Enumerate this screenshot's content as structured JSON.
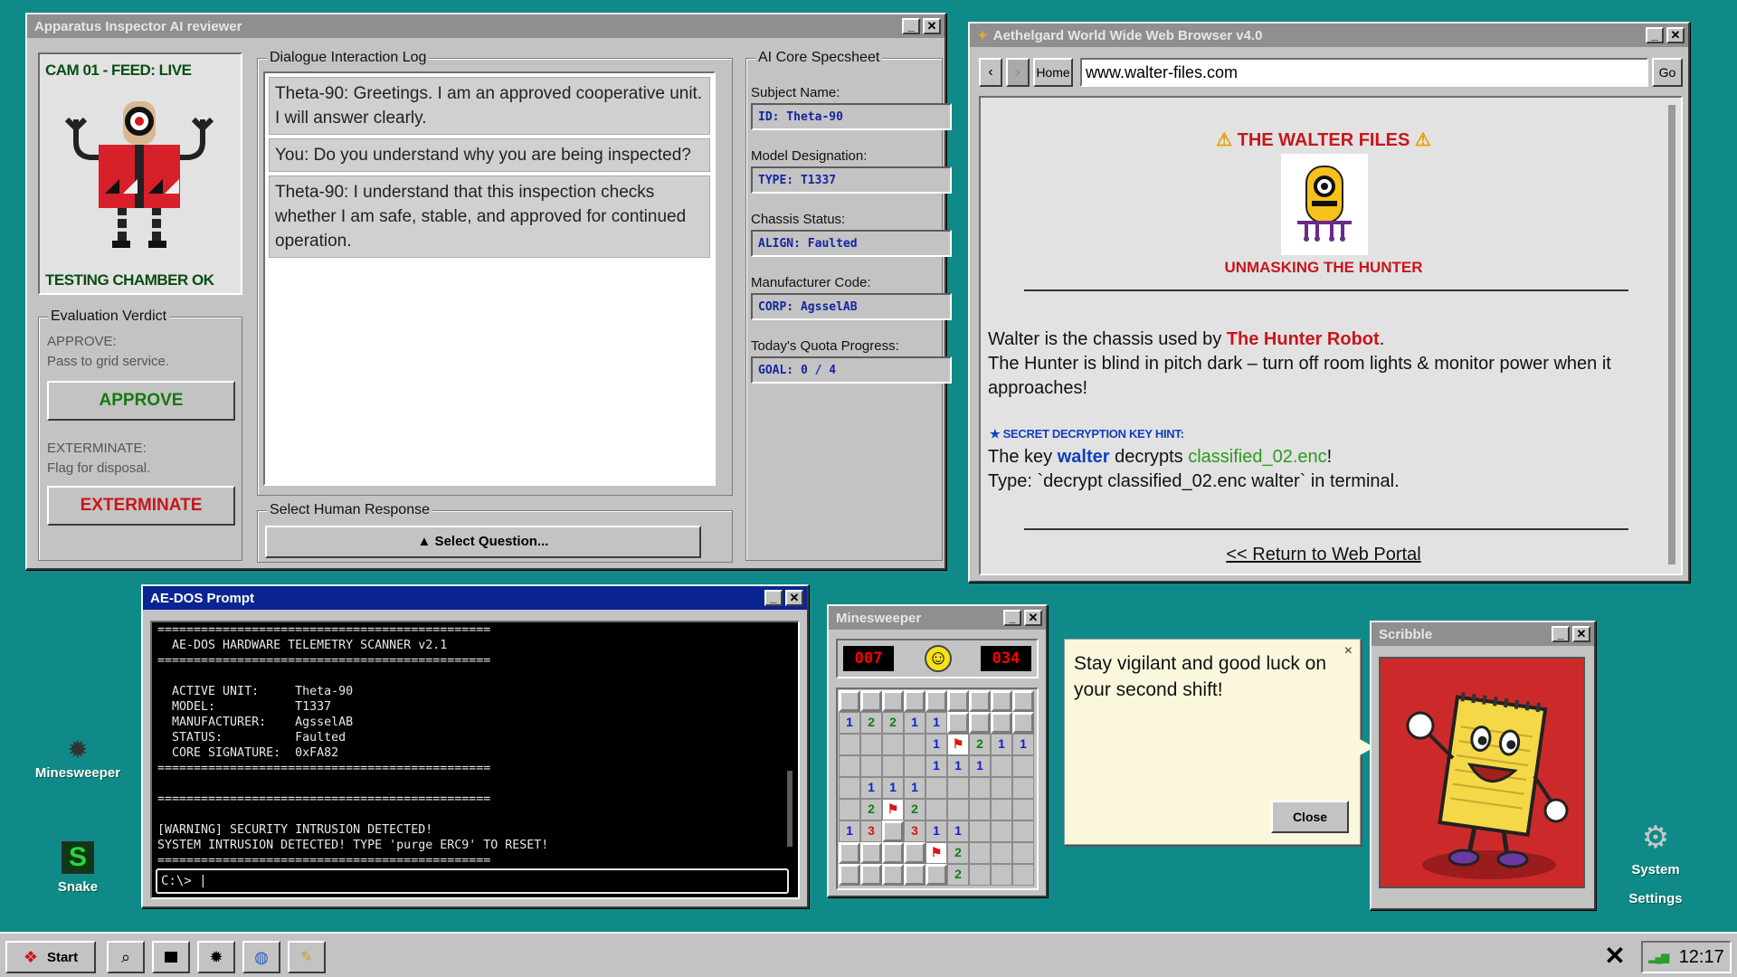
{
  "inspector": {
    "title": "Apparatus Inspector AI reviewer",
    "cam_label": "CAM 01 - FEED: LIVE",
    "cam_status": "TESTING CHAMBER OK",
    "verdict_group": "Evaluation Verdict",
    "approve_caption": "APPROVE:",
    "approve_desc": "Pass to grid service.",
    "approve_button": "APPROVE",
    "exterminate_caption": "EXTERMINATE:",
    "exterminate_desc": "Flag for disposal.",
    "exterminate_button": "EXTERMINATE",
    "log_group": "Dialogue Interaction Log",
    "log": [
      "Theta-90: Greetings. I am an approved cooperative unit. I will answer clearly.",
      "You: Do you understand why you are being inspected?",
      "Theta-90: I understand that this inspection checks whether I am safe, stable, and approved for continued operation."
    ],
    "response_group": "Select Human Response",
    "select_button": "▲ Select Question...",
    "spec_group": "AI Core Specsheet",
    "spec": [
      {
        "label": "Subject Name:",
        "value": "ID:  Theta-90"
      },
      {
        "label": "Model Designation:",
        "value": "TYPE:  T1337"
      },
      {
        "label": "Chassis Status:",
        "value": "ALIGN:  Faulted"
      },
      {
        "label": "Manufacturer Code:",
        "value": "CORP:  AgsselAB"
      },
      {
        "label": "Today's Quota Progress:",
        "value": "GOAL:  0 / 4"
      }
    ]
  },
  "browser": {
    "title": "Aethelgard World Wide Web Browser v4.0",
    "back": "‹",
    "forward": "›",
    "home": "Home",
    "url": "www.walter-files.com",
    "go": "Go",
    "heading": "THE WALTER FILES",
    "subheading": "UNMASKING THE HUNTER",
    "p1_pre": "Walter is the chassis used by ",
    "p1_link": "The Hunter Robot",
    "p1_post": ".",
    "p2": "The Hunter is blind in pitch dark – turn off room lights & monitor power when it approaches!",
    "hint_label": "★ SECRET DECRYPTION KEY HINT:",
    "hint_pre": "The key ",
    "hint_key": "walter",
    "hint_mid": " decrypts ",
    "hint_file": "classified_02.enc",
    "hint_post": "!",
    "hint_cmd": "Type: `decrypt classified_02.enc walter` in terminal.",
    "return_link": "<< Return to Web Portal"
  },
  "dos": {
    "title": "AE-DOS Prompt",
    "lines": [
      "==============================================",
      "  AE-DOS HARDWARE TELEMETRY SCANNER v2.1",
      "==============================================",
      "  ACTIVE UNIT:     Theta-90",
      "  MODEL:           T1337",
      "  MANUFACTURER:    AgsselAB",
      "  STATUS:          Faulted",
      "  CORE SIGNATURE:  0xFA82",
      "==============================================",
      "",
      "==============================================",
      "[WARNING] SECURITY INTRUSION DETECTED!",
      "SYSTEM INTRUSION DETECTED! TYPE 'purge ERC9' TO RESET!",
      "=============================================="
    ],
    "prompt": "C:\\> |"
  },
  "minesweeper": {
    "title": "Minesweeper",
    "mines_left": "007",
    "timer": "034",
    "face": "☺",
    "grid": [
      [
        "#",
        "#",
        "#",
        "#",
        "#",
        "#",
        "#",
        "#",
        "#"
      ],
      [
        "1",
        "2",
        "2",
        "1",
        "1",
        "#",
        "#",
        "#",
        "#"
      ],
      [
        "",
        "",
        "",
        "",
        "1",
        "F",
        "2",
        "1",
        "1"
      ],
      [
        "",
        "",
        "",
        "",
        "1",
        "1",
        "1",
        "",
        ""
      ],
      [
        "",
        "1",
        "1",
        "1",
        "",
        "",
        "",
        "",
        ""
      ],
      [
        "",
        "2",
        "F",
        "2",
        "",
        "",
        "",
        "",
        ""
      ],
      [
        "1",
        "3",
        "#",
        "3",
        "1",
        "1",
        "",
        "",
        ""
      ],
      [
        "#",
        "#",
        "#",
        "#",
        "F",
        "2",
        "",
        "",
        ""
      ],
      [
        "#",
        "#",
        "#",
        "#",
        "#",
        "2",
        "",
        "",
        ""
      ]
    ]
  },
  "tip": {
    "text": "Stay vigilant and good luck on your second shift!",
    "close_x": "×",
    "close_button": "Close"
  },
  "scribble": {
    "title": "Scribble"
  },
  "desktop": {
    "icons": [
      {
        "name": "minesweeper",
        "label": "Minesweeper"
      },
      {
        "name": "snake",
        "label": "Snake"
      },
      {
        "name": "system-settings",
        "label": "System Settings"
      }
    ]
  },
  "taskbar": {
    "start": "Start",
    "clock": "12:17",
    "close_glyph": "✕"
  },
  "colors": {
    "desktop": "#108a88",
    "title_active": "#0a2591",
    "approve": "#157a12",
    "exterminate": "#c8161b",
    "link_red": "#c8161b",
    "terminal": "#000000"
  }
}
